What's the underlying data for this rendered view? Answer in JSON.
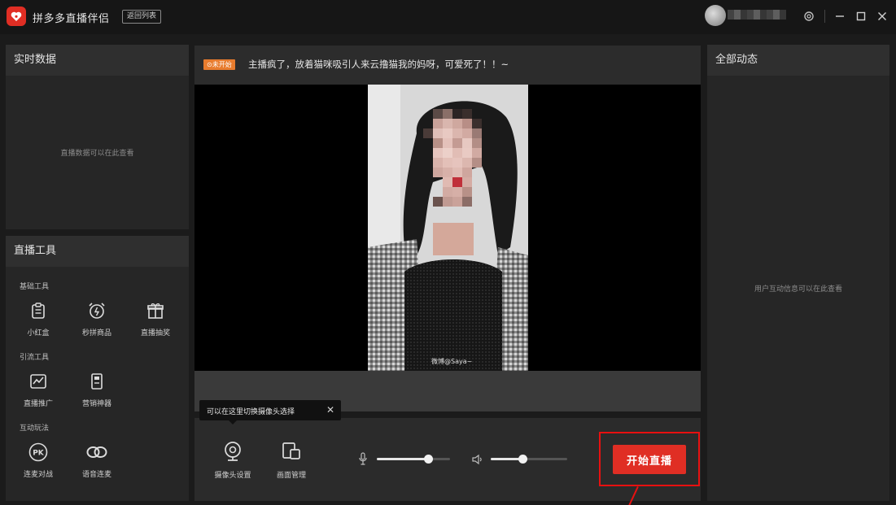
{
  "app": {
    "title": "拼多多直播伴侣",
    "back_to_list": "返回列表"
  },
  "left": {
    "realtime": {
      "title": "实时数据",
      "empty_note": "直播数据可以在此查看"
    },
    "tools": {
      "title": "直播工具",
      "groups": [
        {
          "label": "基础工具",
          "items": [
            {
              "label": "小红盒",
              "icon": "clipboard-icon"
            },
            {
              "label": "秒拼商品",
              "icon": "alarm-clock-icon"
            },
            {
              "label": "直播抽奖",
              "icon": "gift-icon"
            }
          ]
        },
        {
          "label": "引流工具",
          "items": [
            {
              "label": "直播推广",
              "icon": "trend-chart-icon"
            },
            {
              "label": "营销神器",
              "icon": "marketing-icon"
            }
          ]
        },
        {
          "label": "互动玩法",
          "items": [
            {
              "label": "连麦对战",
              "icon": "pk-icon"
            },
            {
              "label": "语音连麦",
              "icon": "link-icon"
            }
          ]
        }
      ]
    }
  },
  "center": {
    "status_badge": "⊙未开始",
    "topic": "主播疯了，放着猫咪吸引人来云撸猫我的妈呀，可爱死了！！~",
    "watermark": "微博@Saya~",
    "tooltip": "可以在这里切换摄像头选择",
    "camera_settings_label": "摄像头设置",
    "scene_manage_label": "画面管理",
    "mic_volume": 0.7,
    "speaker_volume": 0.42,
    "start_label": "开始直播",
    "accent_color": "#e02e24",
    "highlight_color": "#e81010"
  },
  "right": {
    "title": "全部动态",
    "empty_note": "用户互动信息可以在此查看"
  }
}
